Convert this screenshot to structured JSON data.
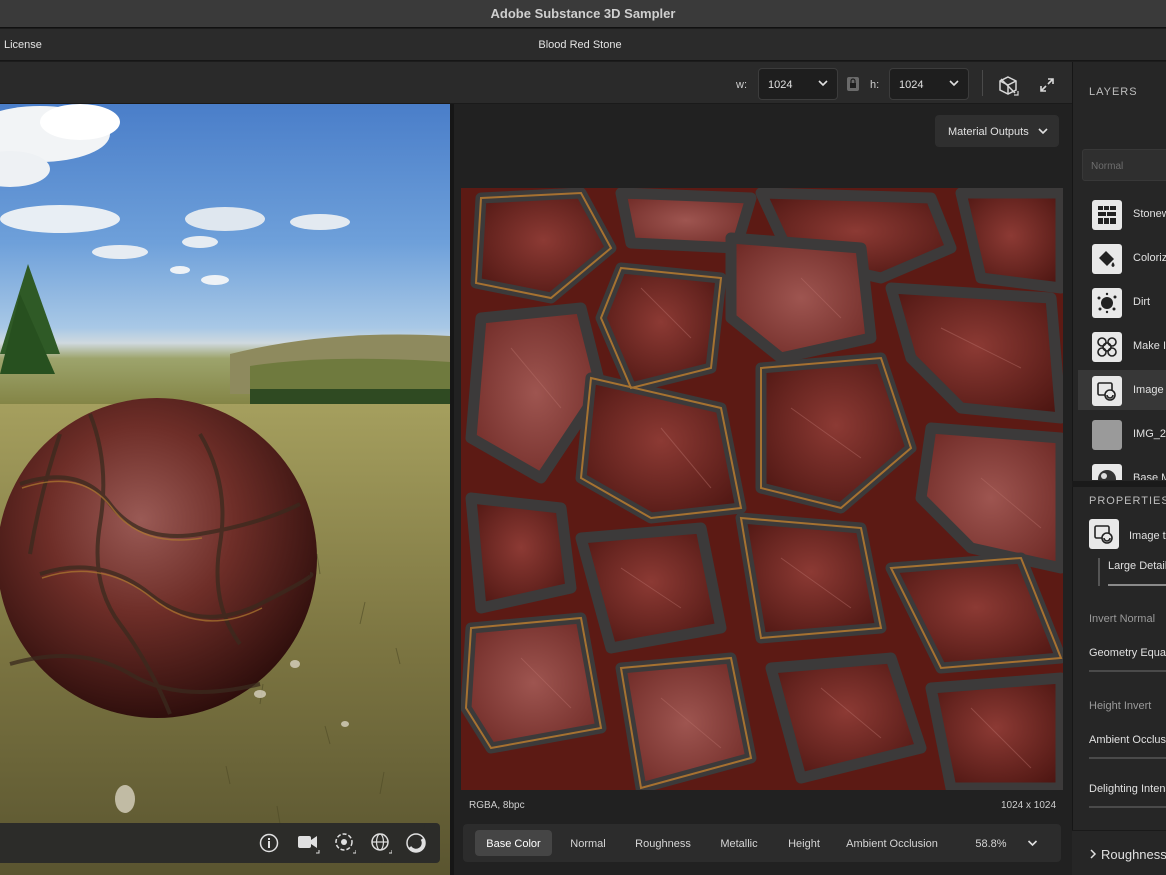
{
  "app": {
    "title": "Adobe Substance 3D Sampler"
  },
  "menubar": {
    "license_label": "License",
    "document_title": "Blood Red Stone"
  },
  "toolbar": {
    "width_label": "w:",
    "width_value": "1024",
    "height_label": "h:",
    "height_value": "1024"
  },
  "view2d": {
    "outputs_dropdown": "Material Outputs",
    "format_info": "RGBA, 8bpc",
    "resolution_info": "1024 x 1024",
    "channels": [
      "Base Color",
      "Normal",
      "Roughness",
      "Metallic",
      "Height",
      "Ambient Occlusion"
    ],
    "active_channel": "Base Color",
    "zoom": "58.8%"
  },
  "layers": {
    "title": "LAYERS",
    "blend_placeholder": "Normal",
    "items": [
      {
        "label": "Stonew",
        "icon": "stonewall-icon"
      },
      {
        "label": "Coloriz",
        "icon": "colorize-icon"
      },
      {
        "label": "Dirt",
        "icon": "dirt-icon"
      },
      {
        "label": "Make I",
        "icon": "make-it-tile-icon"
      },
      {
        "label": "Image t",
        "icon": "image-to-material-icon",
        "selected": true
      },
      {
        "label": "IMG_2",
        "icon": "image-thumbnail"
      },
      {
        "label": "Base M",
        "icon": "base-material-icon"
      }
    ]
  },
  "properties": {
    "title": "PROPERTIES",
    "layer_label": "Image to",
    "tab_label": "Large Detail",
    "fields": [
      "Invert Normal",
      "Geometry Equal",
      "Height Invert",
      "Ambient Occlusi",
      "Delighting Intens"
    ],
    "section": "Roughness"
  },
  "colors": {
    "accent": "#454545",
    "panel": "#262626",
    "background": "#1c1c1c"
  }
}
